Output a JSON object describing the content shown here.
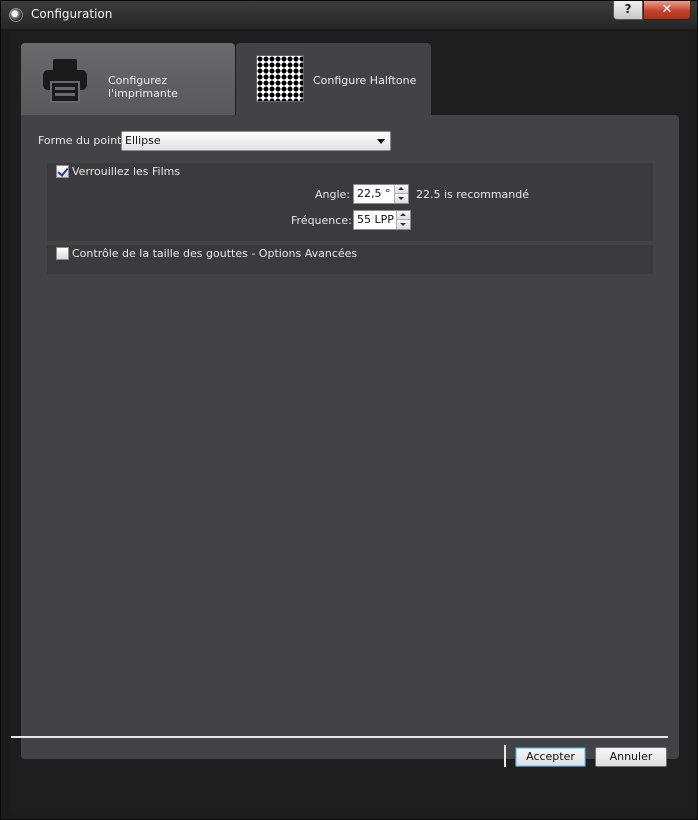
{
  "window": {
    "title": "Configuration",
    "help_label": "?",
    "close_label": "✕"
  },
  "tabs": [
    {
      "label": "Configurez l'imprimante",
      "icon": "printer-icon",
      "active": false
    },
    {
      "label": "Configure Halftone",
      "icon": "halftone-icon",
      "active": true
    }
  ],
  "halftone": {
    "dot_shape_label": "Forme du point:",
    "dot_shape_value": "Ellipse",
    "lock_films_label": "Verrouillez les Films",
    "lock_films_checked": true,
    "angle_label": "Angle:",
    "angle_value": "22,5 °",
    "angle_hint": "22.5 is recommandé",
    "frequency_label": "Fréquence:",
    "frequency_value": "55 LPP",
    "droplet_label": "Contrôle de la taille des gouttes - Options Avancées",
    "droplet_checked": false
  },
  "buttons": {
    "accept": "Accepter",
    "cancel": "Annuler"
  }
}
